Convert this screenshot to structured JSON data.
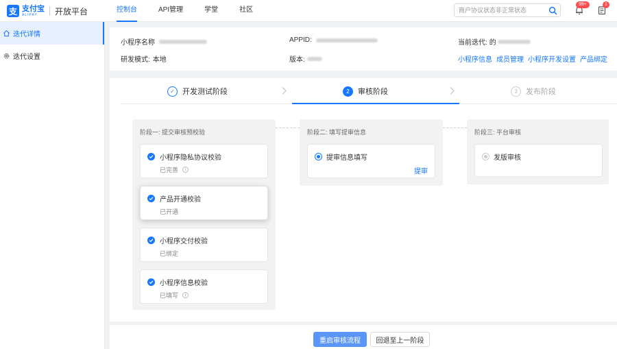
{
  "header": {
    "logo_cn": "支付宝",
    "logo_en": "ALIPAY",
    "platform": "开放平台",
    "nav": [
      "控制台",
      "API管理",
      "学堂",
      "社区"
    ],
    "search_placeholder": "商户协议状态非正常状态",
    "bell_badge": "99+",
    "doc_badge": "1"
  },
  "sidebar": {
    "items": [
      {
        "label": "迭代详情",
        "icon": "home-icon",
        "active": true
      },
      {
        "label": "迭代设置",
        "icon": "gear-icon",
        "active": false
      }
    ]
  },
  "info": {
    "name_label": "小程序名称",
    "appid_label": "APPID:",
    "iteration_label": "当前迭代:",
    "iteration_value": "的",
    "mode_label": "研发模式:",
    "mode_value": "本地",
    "version_label": "版本:",
    "links": [
      "小程序信息",
      "成员管理",
      "小程序开发设置",
      "产品绑定"
    ]
  },
  "steps": [
    {
      "label": "开发测试阶段",
      "marker": "✓",
      "state": "done"
    },
    {
      "label": "审核阶段",
      "marker": "2",
      "state": "active"
    },
    {
      "label": "发布阶段",
      "marker": "3",
      "state": "todo"
    }
  ],
  "stages": {
    "stage1": {
      "title": "阶段一: 提交审核预校验",
      "checks": [
        {
          "title": "小程序隐私协议校验",
          "status": "已完善"
        },
        {
          "title": "产品开通校验",
          "status": "已开通"
        },
        {
          "title": "小程序交付校验",
          "status": "已绑定"
        },
        {
          "title": "小程序信息校验",
          "status": "已填写"
        }
      ]
    },
    "stage2": {
      "title": "阶段二: 填写提审信息",
      "item": "提审信息填写",
      "action": "提审"
    },
    "stage3": {
      "title": "阶段三: 平台审核",
      "item": "发版审核"
    }
  },
  "footer": {
    "primary": "重启审核流程",
    "secondary": "回退至上一阶段"
  },
  "colors": {
    "accent": "#1677ff",
    "badge": "#ff4d4f"
  }
}
